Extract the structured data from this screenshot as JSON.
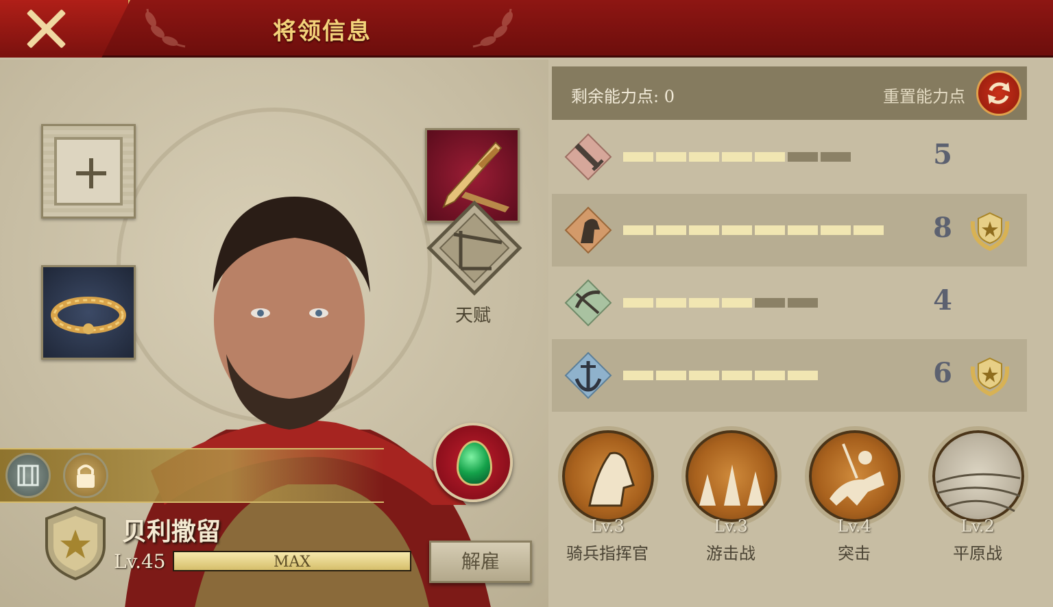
{
  "header": {
    "title": "将领信息"
  },
  "equipment": {
    "talent_label": "天赋"
  },
  "general": {
    "name": "贝利撒留",
    "level_label": "Lv.45",
    "level_progress": 1.0,
    "level_bar_text": "MAX",
    "dismiss_label": "解雇"
  },
  "ability": {
    "remaining_points": "剩余能力点: 0",
    "reset_label": "重置能力点",
    "stats": [
      {
        "icon": "sword-icon",
        "value": "5",
        "filled": 5,
        "total": 7,
        "badge": false
      },
      {
        "icon": "horse-icon",
        "value": "8",
        "filled": 8,
        "total": 8,
        "badge": true
      },
      {
        "icon": "bow-icon",
        "value": "4",
        "filled": 4,
        "total": 6,
        "badge": false
      },
      {
        "icon": "anchor-icon",
        "value": "6",
        "filled": 6,
        "total": 6,
        "badge": true
      }
    ]
  },
  "skills": [
    {
      "level": "Lv.3",
      "name": "骑兵指挥官",
      "icon": "horse-head-icon"
    },
    {
      "level": "Lv.3",
      "name": "游击战",
      "icon": "horsemen-icon"
    },
    {
      "level": "Lv.4",
      "name": "突击",
      "icon": "charging-rider-icon"
    },
    {
      "level": "Lv.2",
      "name": "平原战",
      "icon": "plains-icon"
    }
  ],
  "colors": {
    "header_red": "#8e1613",
    "gold_text": "#f3d37a",
    "bar_fill": "#f1e6b2",
    "bar_empty": "#8b8166"
  }
}
